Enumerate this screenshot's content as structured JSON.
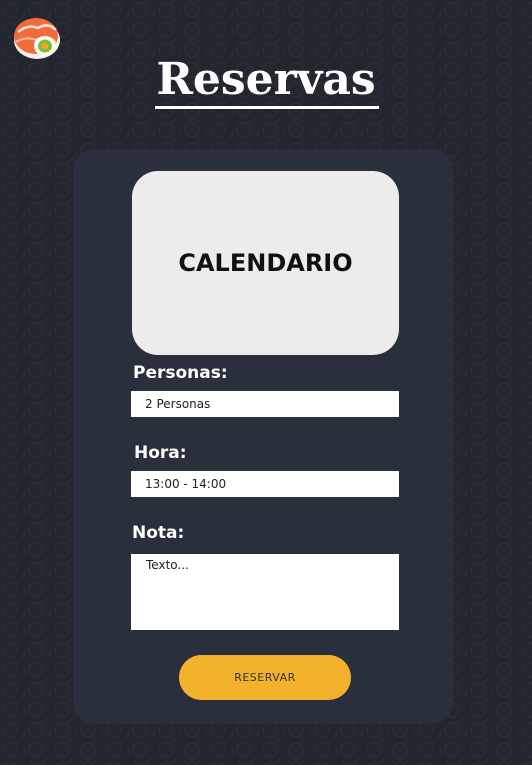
{
  "header": {
    "title": "Reservas"
  },
  "form": {
    "calendar_label": "CALENDARIO",
    "persons_label": "Personas:",
    "persons_value": "2 Personas",
    "time_label": "Hora:",
    "time_value": "13:00 - 14:00",
    "note_label": "Nota:",
    "note_placeholder": "Texto...",
    "submit_label": "RESERVAR"
  },
  "colors": {
    "background": "#23262e",
    "card": "#2a2f3e",
    "accent": "#f2b22b",
    "calendar_bg": "#ececec"
  },
  "icons": {
    "logo": "sushi-roll-icon"
  }
}
